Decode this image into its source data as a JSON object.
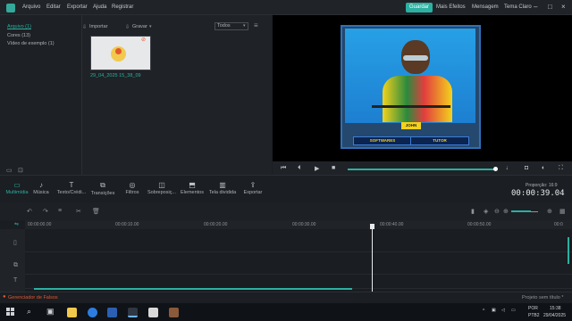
{
  "menubar": {
    "items": [
      "Arquivo",
      "Editar",
      "Exportar",
      "Ajuda",
      "Registrar"
    ],
    "save_label": "Guardar",
    "effects_label": "Mais Efeitos",
    "messages_label": "Mensagem",
    "theme_label": "Tema Claro"
  },
  "library": {
    "nav": [
      "Arquivo (1)",
      "Cores (13)",
      "Vídeo de exemplo (1)"
    ],
    "import_label": "Importar",
    "record_label": "Gravar",
    "filter_value": "Todos",
    "clip_name": "29_04_2025 15_38_09"
  },
  "preview": {
    "name_tag": "JOHN",
    "pill_left": "SOFTWARES",
    "pill_right": "TUTOR"
  },
  "toolbar": {
    "tools": [
      "Multimídia",
      "Música",
      "Texto/Crédi...",
      "Transições",
      "Filtros",
      "Sobreposiç...",
      "Elementos",
      "Tela dividida",
      "Exportar"
    ],
    "proportion_label": "Proporção: 16:9",
    "timecode": "00:00:39.04"
  },
  "timeline": {
    "ticks": [
      "00:00:00.00",
      "00:00:10.00",
      "00:00:20.00",
      "00:00:30.00",
      "00:00:40.00",
      "00:00:50.00",
      "00:0"
    ]
  },
  "statusbar": {
    "left": "Gerenciador de Falsos",
    "right": "Projeto sem título *"
  },
  "taskbar": {
    "lang": "POR",
    "lang2": "PTB2",
    "time": "15:38",
    "date": "29/04/2025"
  },
  "colors": {
    "accent": "#2bb0a1",
    "alert": "#e4572e"
  }
}
